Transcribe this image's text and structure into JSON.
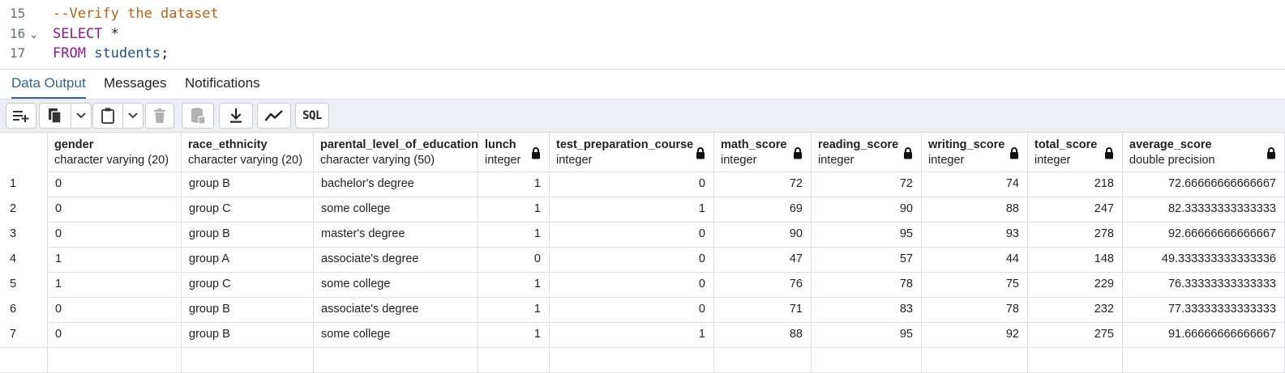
{
  "editor": {
    "lines": [
      {
        "num": "15",
        "fold": "",
        "tokens": [
          {
            "text": "--Verify the dataset",
            "kind": "comment"
          }
        ]
      },
      {
        "num": "16",
        "fold": "⌄",
        "tokens": [
          {
            "text": "SELECT",
            "kind": "kw"
          },
          {
            "text": " *",
            "kind": "plain"
          }
        ]
      },
      {
        "num": "17",
        "fold": "",
        "tokens": [
          {
            "text": "FROM",
            "kind": "kw"
          },
          {
            "text": " ",
            "kind": "plain"
          },
          {
            "text": "students",
            "kind": "ident"
          },
          {
            "text": ";",
            "kind": "plain"
          }
        ]
      }
    ]
  },
  "tabs": [
    {
      "label": "Data Output",
      "active": true
    },
    {
      "label": "Messages",
      "active": false
    },
    {
      "label": "Notifications",
      "active": false
    }
  ],
  "toolbar": {
    "buttons": [
      {
        "name": "add-row-button",
        "icon": "add-row-icon"
      },
      {
        "name": "copy-button",
        "icon": "copy-icon"
      },
      {
        "name": "copy-options-dropdown",
        "icon": "chevron-down-icon"
      },
      {
        "name": "paste-button",
        "icon": "paste-icon"
      },
      {
        "name": "paste-options-dropdown",
        "icon": "chevron-down-icon"
      },
      {
        "name": "delete-button",
        "icon": "trash-icon"
      },
      {
        "name": "save-data-button",
        "icon": "database-save-icon"
      },
      {
        "name": "download-button",
        "icon": "download-icon"
      },
      {
        "name": "graph-visualiser-button",
        "icon": "line-chart-icon"
      },
      {
        "name": "sql-button",
        "label": "SQL"
      }
    ]
  },
  "grid": {
    "columns": [
      {
        "name": "gender",
        "type": "character varying (20)",
        "locked": false,
        "align": "left"
      },
      {
        "name": "race_ethnicity",
        "type": "character varying (20)",
        "locked": false,
        "align": "left"
      },
      {
        "name": "parental_level_of_education",
        "type": "character varying (50)",
        "locked": false,
        "align": "left"
      },
      {
        "name": "lunch",
        "type": "integer",
        "locked": true,
        "align": "right"
      },
      {
        "name": "test_preparation_course",
        "type": "integer",
        "locked": true,
        "align": "right"
      },
      {
        "name": "math_score",
        "type": "integer",
        "locked": true,
        "align": "right"
      },
      {
        "name": "reading_score",
        "type": "integer",
        "locked": true,
        "align": "right"
      },
      {
        "name": "writing_score",
        "type": "integer",
        "locked": true,
        "align": "right"
      },
      {
        "name": "total_score",
        "type": "integer",
        "locked": true,
        "align": "right"
      },
      {
        "name": "average_score",
        "type": "double precision",
        "locked": true,
        "align": "right"
      }
    ],
    "rows": [
      {
        "rownum": "1",
        "cells": [
          "0",
          "group B",
          "bachelor's degree",
          "1",
          "0",
          "72",
          "72",
          "74",
          "218",
          "72.66666666666667"
        ]
      },
      {
        "rownum": "2",
        "cells": [
          "0",
          "group C",
          "some college",
          "1",
          "1",
          "69",
          "90",
          "88",
          "247",
          "82.33333333333333"
        ]
      },
      {
        "rownum": "3",
        "cells": [
          "0",
          "group B",
          "master's degree",
          "1",
          "0",
          "90",
          "95",
          "93",
          "278",
          "92.66666666666667"
        ]
      },
      {
        "rownum": "4",
        "cells": [
          "1",
          "group A",
          "associate's degree",
          "0",
          "0",
          "47",
          "57",
          "44",
          "148",
          "49.333333333333336"
        ]
      },
      {
        "rownum": "5",
        "cells": [
          "1",
          "group C",
          "some college",
          "1",
          "0",
          "76",
          "78",
          "75",
          "229",
          "76.33333333333333"
        ]
      },
      {
        "rownum": "6",
        "cells": [
          "0",
          "group B",
          "associate's degree",
          "1",
          "0",
          "71",
          "83",
          "78",
          "232",
          "77.33333333333333"
        ]
      },
      {
        "rownum": "7",
        "cells": [
          "0",
          "group B",
          "some college",
          "1",
          "1",
          "88",
          "95",
          "92",
          "275",
          "91.66666666666667"
        ]
      }
    ]
  },
  "colors": {
    "accent": "#326690",
    "keyword": "#8d1a8d",
    "comment": "#b3631b",
    "identifier": "#1f4f8b"
  }
}
